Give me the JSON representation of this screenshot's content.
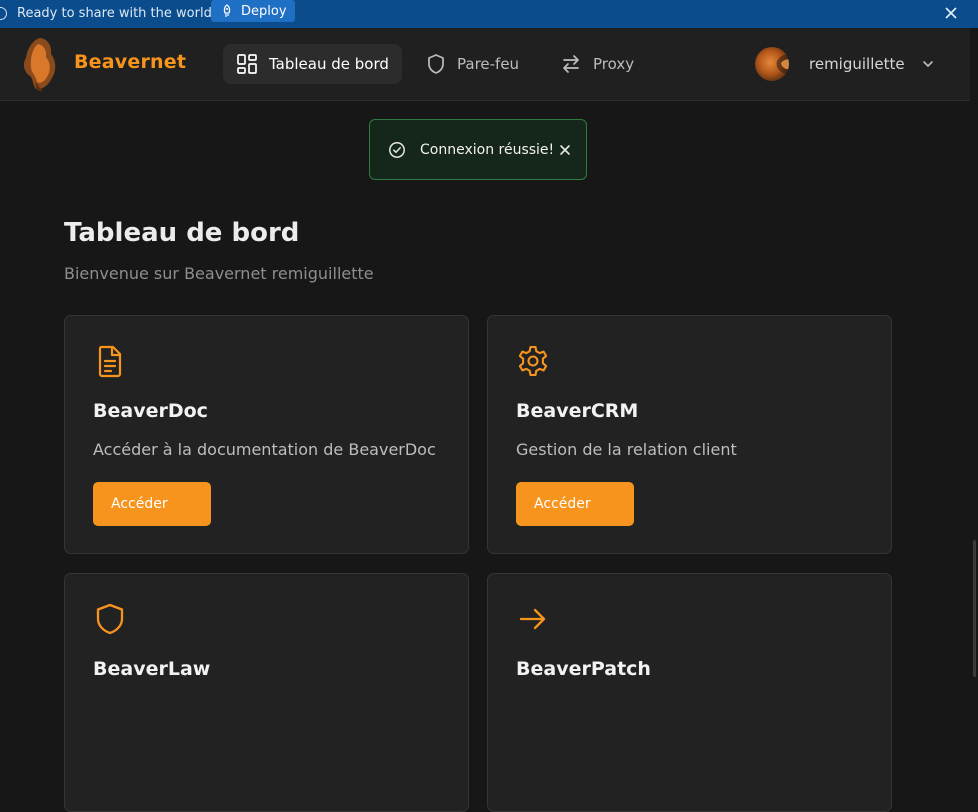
{
  "banner": {
    "text": "Ready to share with the world?",
    "deploy_label": "Deploy"
  },
  "navbar": {
    "brand": "Beavernet",
    "items": [
      {
        "label": "Tableau de bord",
        "icon": "dashboard-grid-icon",
        "active": true
      },
      {
        "label": "Pare-feu",
        "icon": "shield-icon",
        "active": false
      },
      {
        "label": "Proxy",
        "icon": "arrows-left-right-icon",
        "active": false
      }
    ],
    "user": {
      "name": "remiguillette"
    }
  },
  "toast": {
    "message": "Connexion réussie!"
  },
  "main": {
    "title": "Tableau de bord",
    "subtitle": "Bienvenue sur Beavernet remiguillette",
    "cards": [
      {
        "title": "BeaverDoc",
        "description": "Accéder à la documentation de BeaverDoc",
        "button": "Accéder",
        "icon": "document-icon"
      },
      {
        "title": "BeaverCRM",
        "description": "Gestion de la relation client",
        "button": "Accéder",
        "icon": "gear-icon"
      },
      {
        "title": "BeaverLaw",
        "icon": "shield-icon"
      },
      {
        "title": "BeaverPatch",
        "icon": "arrow-right-icon"
      }
    ]
  },
  "colors": {
    "accent": "#f7941d",
    "background": "#171717",
    "card": "#222222",
    "banner": "#0b4c8c",
    "toast_border": "#2f7b41"
  }
}
